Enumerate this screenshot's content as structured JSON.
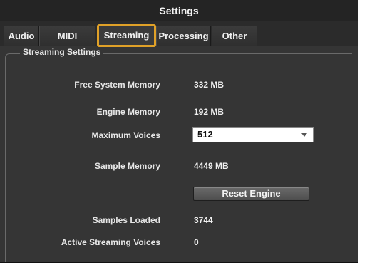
{
  "window": {
    "title": "Settings"
  },
  "tabs": [
    {
      "label": "Audio"
    },
    {
      "label": "MIDI"
    },
    {
      "label": "Streaming"
    },
    {
      "label": "Processing"
    },
    {
      "label": "Other"
    }
  ],
  "active_tab": "Streaming",
  "group": {
    "title": "Streaming Settings"
  },
  "rows": {
    "free_memory": {
      "label": "Free System Memory",
      "value": "332 MB"
    },
    "engine_memory": {
      "label": "Engine Memory",
      "value": "192 MB"
    },
    "max_voices": {
      "label": "Maximum Voices",
      "value": "512"
    },
    "sample_memory": {
      "label": "Sample Memory",
      "value": "4449 MB"
    },
    "samples_loaded": {
      "label": "Samples Loaded",
      "value": "3744"
    },
    "active_voices": {
      "label": "Active Streaming Voices",
      "value": "0"
    }
  },
  "reset_button": {
    "label": "Reset Engine"
  },
  "colors": {
    "window_bg": "#2b2b2b",
    "panel_bg": "#353535",
    "active_tab_outline": "#e0a128",
    "text": "#e6e6e6"
  }
}
